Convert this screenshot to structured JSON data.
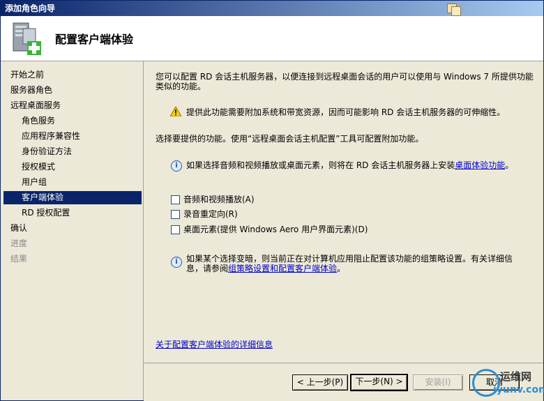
{
  "window": {
    "title": "添加角色向导"
  },
  "header": {
    "title": "配置客户端体验"
  },
  "sidebar": {
    "items": [
      {
        "label": "开始之前",
        "state": "normal",
        "level": "top"
      },
      {
        "label": "服务器角色",
        "state": "normal",
        "level": "top"
      },
      {
        "label": "远程桌面服务",
        "state": "normal",
        "level": "top"
      },
      {
        "label": "角色服务",
        "state": "normal",
        "level": "sub"
      },
      {
        "label": "应用程序兼容性",
        "state": "normal",
        "level": "sub"
      },
      {
        "label": "身份验证方法",
        "state": "normal",
        "level": "sub"
      },
      {
        "label": "授权模式",
        "state": "normal",
        "level": "sub"
      },
      {
        "label": "用户组",
        "state": "normal",
        "level": "sub"
      },
      {
        "label": "客户端体验",
        "state": "active",
        "level": "sub"
      },
      {
        "label": "RD 授权配置",
        "state": "normal",
        "level": "sub"
      },
      {
        "label": "确认",
        "state": "normal",
        "level": "top"
      },
      {
        "label": "进度",
        "state": "disabled",
        "level": "top"
      },
      {
        "label": "结果",
        "state": "disabled",
        "level": "top"
      }
    ]
  },
  "main": {
    "intro_line1": "您可以配置 RD 会话主机服务器，以便连接到远程桌面会话的用户可以使用与 Windows 7 所提供功能",
    "intro_line2": "类似的功能。",
    "warning": "提供此功能需要附加系统和带宽资源，因而可能影响 RD 会话主机服务器的可伸缩性。",
    "select_prompt": "选择要提供的功能。使用“远程桌面会话主机配置”工具可配置附加功能。",
    "info1_text": "如果选择音频和视频播放或桌面元素，则将在 RD 会话主机服务器上安装",
    "info1_link": "桌面体验功能",
    "info1_end": "。",
    "options": [
      {
        "label": "音频和视频播放(A)",
        "checked": false
      },
      {
        "label": "录音重定向(R)",
        "checked": false
      },
      {
        "label": "桌面元素(提供 Windows Aero 用户界面元素)(D)",
        "checked": false
      }
    ],
    "info2_line1": "如果某个选择变暗，则当前正在对计算机应用阻止配置该功能的组策略设置。有关详细信",
    "info2_line2_prefix": "息，请参阅",
    "info2_link": "组策略设置和配置客户端体验",
    "info2_end": "。",
    "more_info_link": "关于配置客户端体验的详细信息"
  },
  "footer": {
    "back_label": "< 上一步(P)",
    "next_label": "下一步(N) >",
    "install_label": "安装(I)",
    "cancel_label": "取消"
  },
  "watermark": {
    "text1": "运维网",
    "text2": "iyunv.com"
  },
  "colors": {
    "selection": "#0a246a",
    "link": "#0000cc",
    "background": "#ece9d8"
  }
}
